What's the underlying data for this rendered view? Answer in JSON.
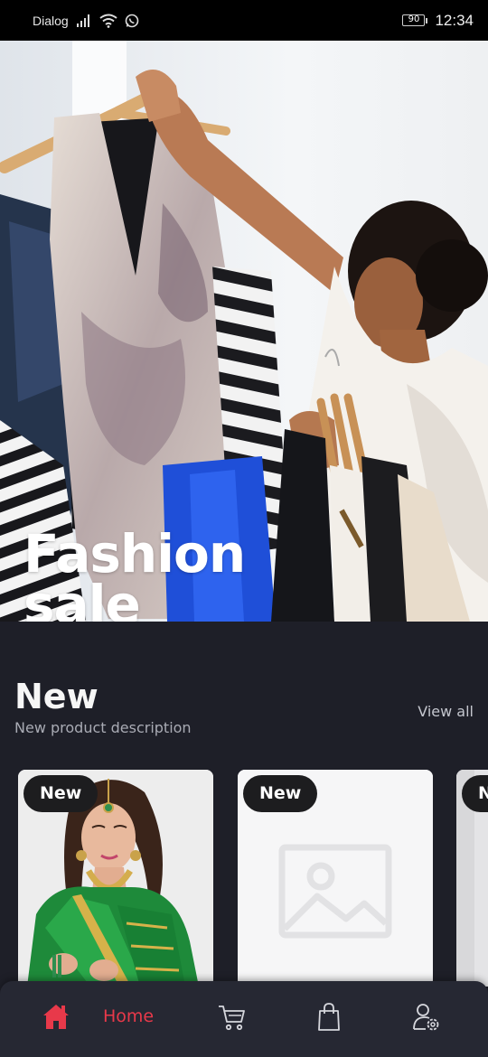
{
  "status_bar": {
    "carrier": "Dialog",
    "battery": "90",
    "time": "12:34"
  },
  "hero": {
    "title": "Fashion\nsale"
  },
  "new_section": {
    "title": "New",
    "description": "New product description",
    "view_all": "View all"
  },
  "products": [
    {
      "badge": "New",
      "image": "saree-model-photo"
    },
    {
      "badge": "New",
      "image": "image-placeholder-icon"
    },
    {
      "badge": "New",
      "image": "product-photo"
    }
  ],
  "bottom_nav": {
    "items": [
      {
        "label": "Home",
        "icon": "home-icon",
        "active": true
      },
      {
        "icon": "cart-icon",
        "active": false
      },
      {
        "icon": "shopping-bag-icon",
        "active": false
      },
      {
        "icon": "profile-settings-icon",
        "active": false
      }
    ]
  },
  "colors": {
    "background": "#1e1f28",
    "accent": "#e8394a",
    "nav_background": "#262833",
    "badge": "#1d1d1f"
  }
}
